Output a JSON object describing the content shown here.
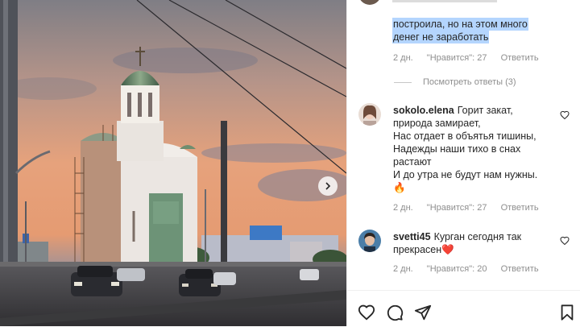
{
  "post": {
    "top_comment_tail": [
      "построила, но на этом много",
      "денег не заработать"
    ],
    "top_meta": {
      "age": "2 дн.",
      "likes": "\"Нравится\": 27",
      "reply": "Ответить"
    },
    "view_replies": "Посмотреть ответы (3)"
  },
  "comments": [
    {
      "user": "sokolo.elena",
      "text_lines": [
        "Горит закат,",
        "природа замирает,",
        "Нас отдает в объятья тишины,",
        "Надежды наши тихо в снах",
        "растают",
        "И до утра не будут нам нужны."
      ],
      "emoji": "🔥",
      "age": "2 дн.",
      "likes": "\"Нравится\": 27",
      "reply": "Ответить"
    },
    {
      "user": "svetti45",
      "text_lines": [
        "Курган сегодня так",
        "прекрасен"
      ],
      "emoji": "❤️",
      "age": "2 дн.",
      "likes": "\"Нравится\": 20",
      "reply": "Ответить"
    }
  ],
  "icons": {
    "like": "heart-icon",
    "comment": "comment-icon",
    "share": "paper-plane-icon",
    "save": "bookmark-icon",
    "next": "chevron-right-icon"
  },
  "colors": {
    "sky_top": "#8e8a8c",
    "sky_glow": "#e8a27a",
    "church_white": "#ece9e6",
    "dome_green": "#5f7f63",
    "highlight": "#b4d5fe",
    "meta_gray": "#8e8e8e"
  }
}
